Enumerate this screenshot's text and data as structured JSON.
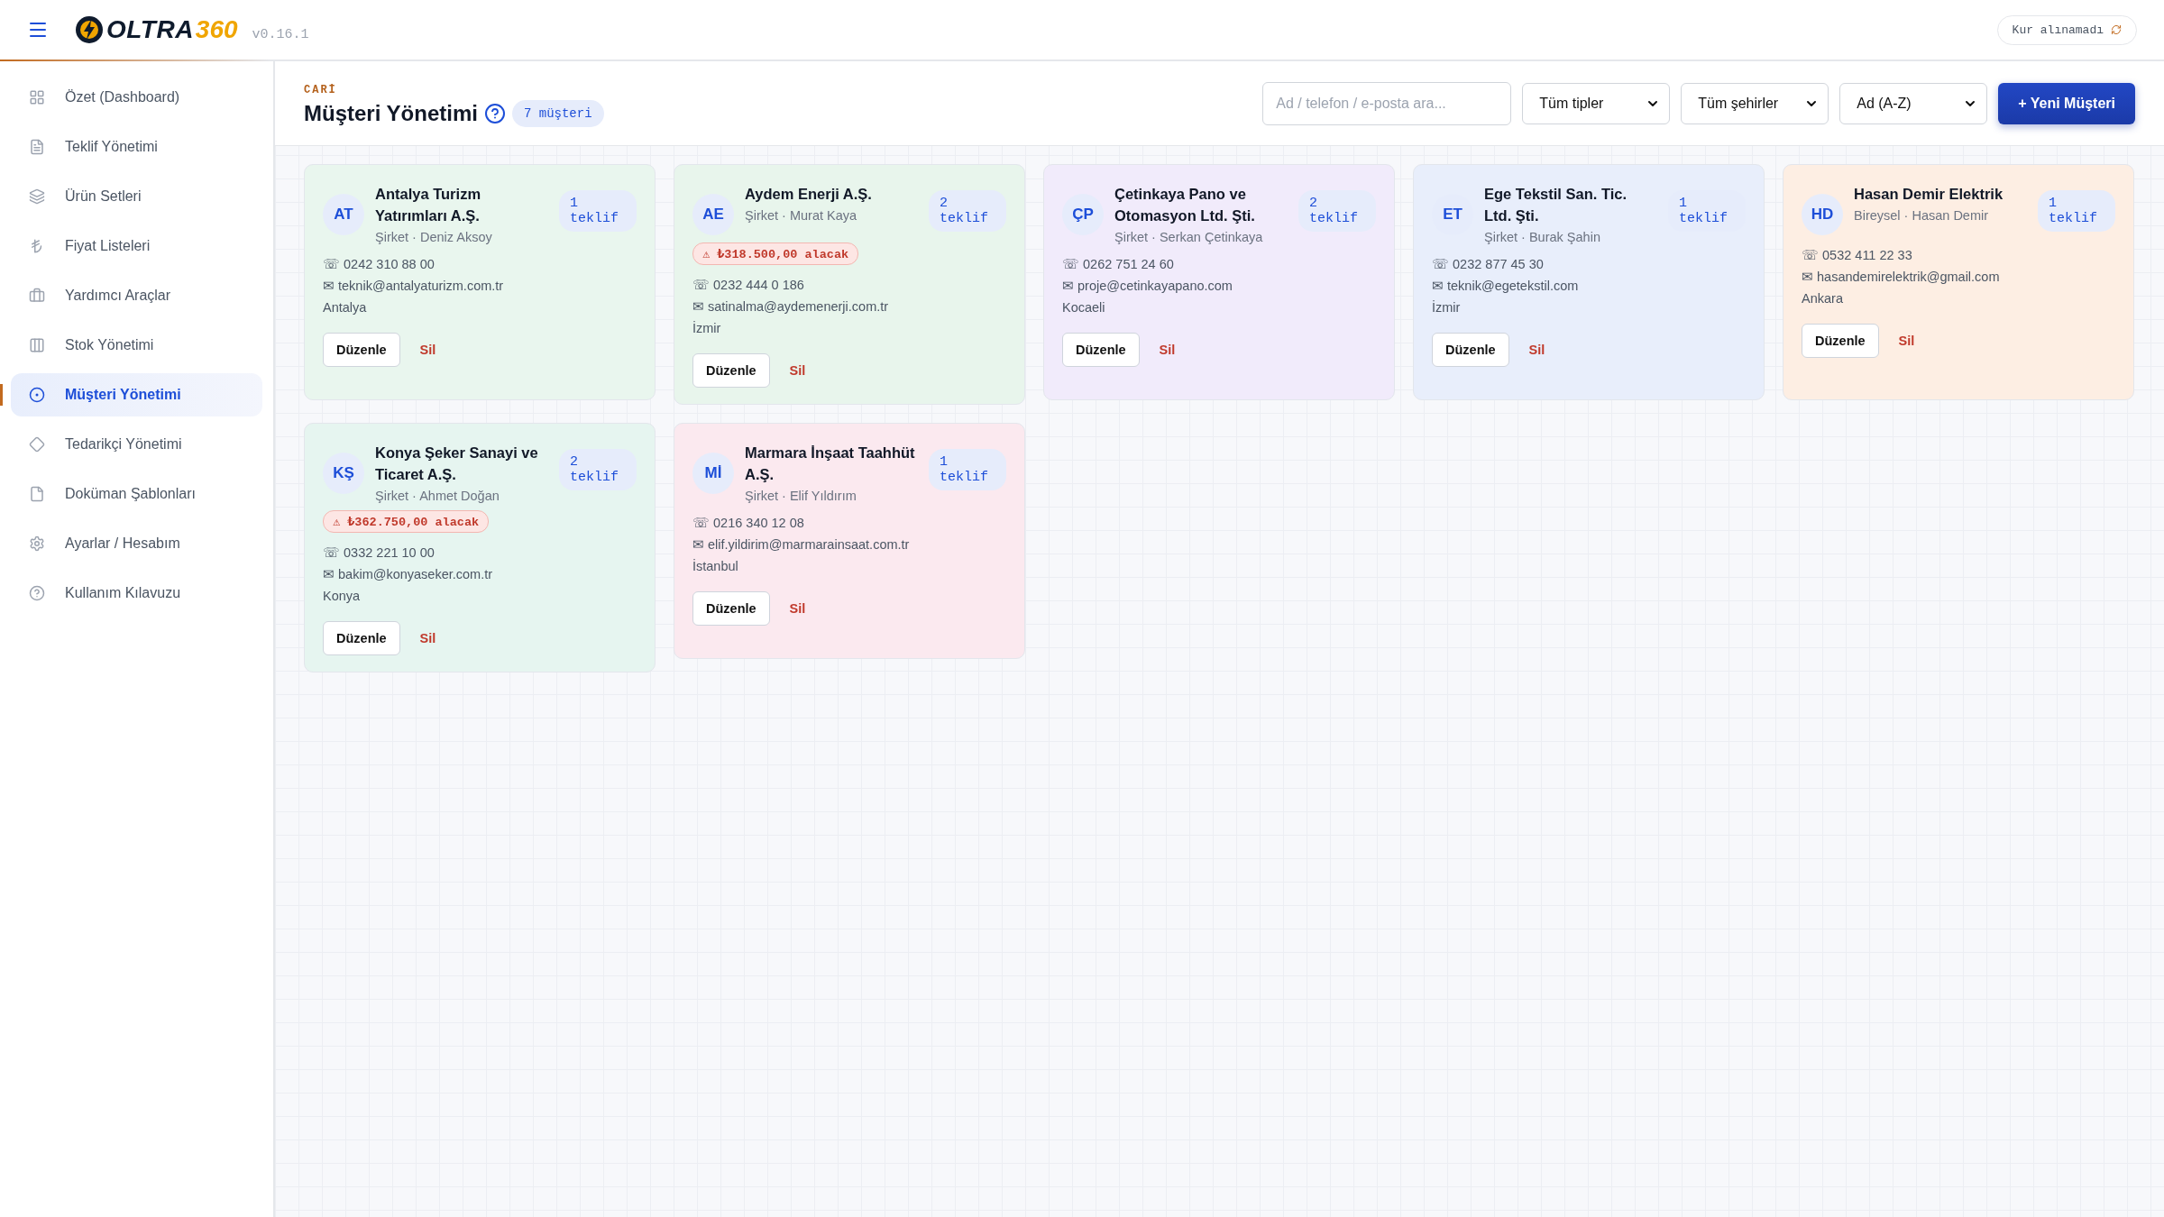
{
  "header": {
    "brand": {
      "name": "OLTRA",
      "suffix": "360"
    },
    "version": "v0.16.1",
    "rate_status": "Kur alınamadı"
  },
  "sidebar": {
    "items": [
      {
        "label": "Özet (Dashboard)",
        "selected": false
      },
      {
        "label": "Teklif Yönetimi",
        "selected": false
      },
      {
        "label": "Ürün Setleri",
        "selected": false
      },
      {
        "label": "Fiyat Listeleri",
        "selected": false
      },
      {
        "label": "Yardımcı Araçlar",
        "selected": false
      },
      {
        "label": "Stok Yönetimi",
        "selected": false
      },
      {
        "label": "Müşteri Yönetimi",
        "selected": true
      },
      {
        "label": "Tedarikçi Yönetimi",
        "selected": false
      },
      {
        "label": "Doküman Şablonları",
        "selected": false
      },
      {
        "label": "Ayarlar / Hesabım",
        "selected": false
      },
      {
        "label": "Kullanım Kılavuzu",
        "selected": false
      }
    ]
  },
  "page": {
    "section": "CARİ",
    "title": "Müşteri Yönetimi",
    "count": "7 müşteri",
    "search": {
      "placeholder": "Ad / telefon / e-posta ara..."
    },
    "filters": [
      {
        "value": "Tüm tipler"
      },
      {
        "value": "Tüm şehirler"
      },
      {
        "value": "Ad (A-Z)"
      }
    ],
    "new_button": "+ Yeni Müşteri"
  },
  "customers": [
    {
      "initials": "AT",
      "name": "Antalya Turizm Yatırımları A.Ş.",
      "subtitle": "Şirket · Deniz Aksoy",
      "offers": "1 teklif",
      "phone": "☏ 0242 310 88 00",
      "email": "✉ teknik@antalyaturizm.com.tr",
      "city": "Antalya",
      "color": "#e9f6ee",
      "edit": "Düzenle",
      "delete": "Sil"
    },
    {
      "initials": "AE",
      "name": "Aydem Enerji A.Ş.",
      "subtitle": "Şirket · Murat Kaya",
      "offers": "2 teklif",
      "debt": "⚠ ₺318.500,00 alacak",
      "phone": "☏ 0232 444 0 186",
      "email": "✉ satinalma@aydemenerji.com.tr",
      "city": "İzmir",
      "color": "#e8f5ec",
      "edit": "Düzenle",
      "delete": "Sil"
    },
    {
      "initials": "ÇP",
      "name": "Çetinkaya Pano ve Otomasyon Ltd. Şti.",
      "subtitle": "Şirket · Serkan Çetinkaya",
      "offers": "2 teklif",
      "phone": "☏ 0262 751 24 60",
      "email": "✉ proje@cetinkayapano.com",
      "city": "Kocaeli",
      "color": "#f1ebfb",
      "edit": "Düzenle",
      "delete": "Sil"
    },
    {
      "initials": "ET",
      "name": "Ege Tekstil San. Tic. Ltd. Şti.",
      "subtitle": "Şirket · Burak Şahin",
      "offers": "1 teklif",
      "phone": "☏ 0232 877 45 30",
      "email": "✉ teknik@egetekstil.com",
      "city": "İzmir",
      "color": "#e8eefb",
      "edit": "Düzenle",
      "delete": "Sil"
    },
    {
      "initials": "HD",
      "name": "Hasan Demir Elektrik",
      "subtitle": "Bireysel · Hasan Demir",
      "offers": "1 teklif",
      "phone": "☏ 0532 411 22 33",
      "email": "✉ hasandemirelektrik@gmail.com",
      "city": "Ankara",
      "color": "#fdeee3",
      "edit": "Düzenle",
      "delete": "Sil"
    },
    {
      "initials": "KŞ",
      "name": "Konya Şeker Sanayi ve Ticaret A.Ş.",
      "subtitle": "Şirket · Ahmet Doğan",
      "offers": "2 teklif",
      "debt": "⚠ ₺362.750,00 alacak",
      "phone": "☏ 0332 221 10 00",
      "email": "✉ bakim@konyaseker.com.tr",
      "city": "Konya",
      "color": "#e6f5f0",
      "edit": "Düzenle",
      "delete": "Sil"
    },
    {
      "initials": "Mİ",
      "name": "Marmara İnşaat Taahhüt A.Ş.",
      "subtitle": "Şirket · Elif Yıldırım",
      "offers": "1 teklif",
      "phone": "☏ 0216 340 12 08",
      "email": "✉ elif.yildirim@marmarainsaat.com.tr",
      "city": "İstanbul",
      "color": "#fbe9ef",
      "edit": "Düzenle",
      "delete": "Sil"
    }
  ]
}
